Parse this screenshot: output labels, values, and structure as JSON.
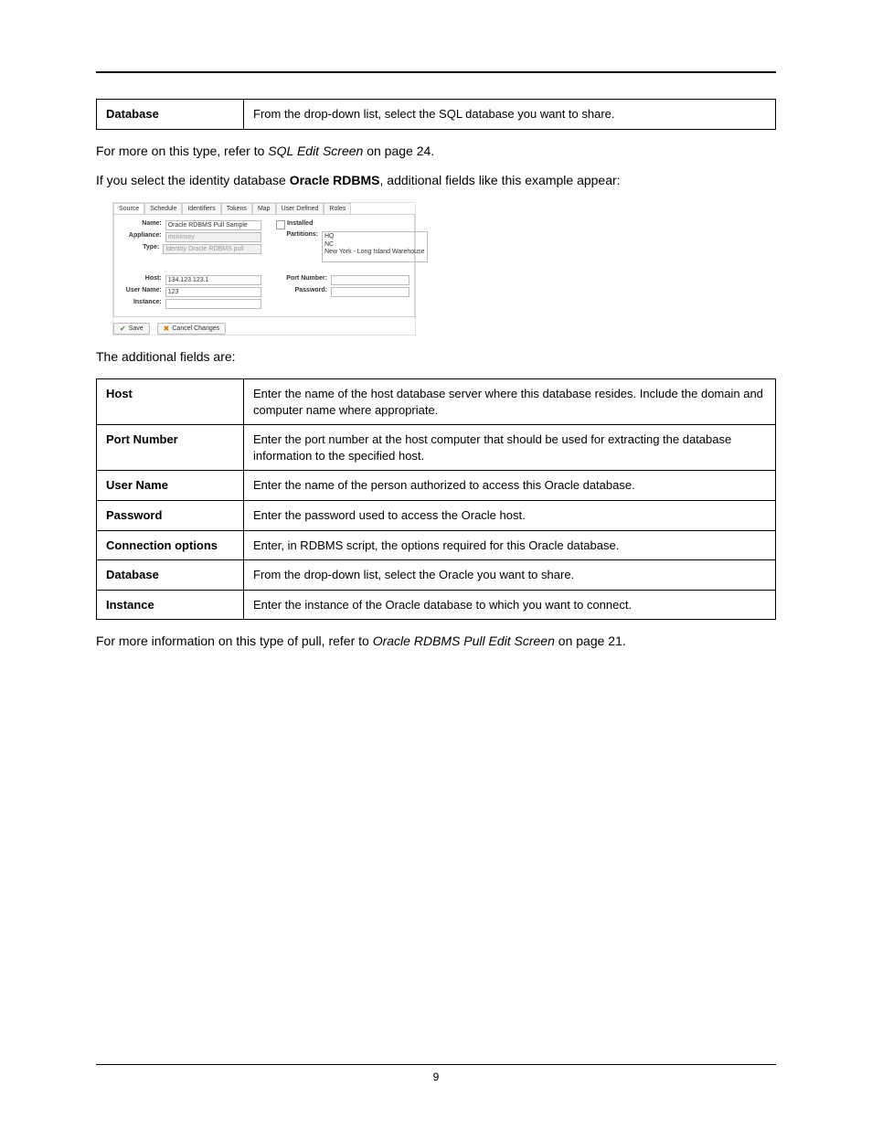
{
  "top_table": {
    "field": "Database",
    "desc": "From the drop-down list, select the SQL database you want to share."
  },
  "p1": {
    "prefix": "For more on this type, refer to ",
    "ital": "SQL Edit Screen",
    "suffix": " on page 24."
  },
  "p2": {
    "prefix": "If you select the identity database ",
    "bold": "Oracle RDBMS",
    "suffix": ", additional fields like this example appear:"
  },
  "shot": {
    "tabs": [
      "Source",
      "Schedule",
      "Identifiers",
      "Tokens",
      "Map",
      "User Defined",
      "Roles"
    ],
    "labels": {
      "name": "Name:",
      "appliance": "Appliance:",
      "type": "Type:",
      "installed": "Installed",
      "partitions": "Partitions:",
      "host": "Host:",
      "port": "Port Number:",
      "user": "User Name:",
      "password": "Password:",
      "instance": "Instance:"
    },
    "values": {
      "name": "Oracle RDBMS Pull Sample",
      "appliance": "mckinsey",
      "type": "Identity Oracle RDBMS pull",
      "host": "134.123.123.1",
      "user": "123",
      "partitions": [
        "HQ",
        "NC",
        "New York - Long Island Warehouse"
      ]
    },
    "buttons": {
      "save": "Save",
      "cancel": "Cancel Changes"
    }
  },
  "p3": "The additional fields are:",
  "fields_table": [
    {
      "k": "Host",
      "v": "Enter the name of the host database server where this database resides. Include the domain and computer name where appropriate."
    },
    {
      "k": "Port Number",
      "v": "Enter the port number at the host computer that should be used for extracting the database information to the specified host."
    },
    {
      "k": "User Name",
      "v": "Enter the name of the person authorized to access this Oracle database."
    },
    {
      "k": "Password",
      "v": "Enter the password used to access the Oracle host."
    },
    {
      "k": "Connection options",
      "v": "Enter, in RDBMS script, the options required for this Oracle database."
    },
    {
      "k": "Database",
      "v": "From the drop-down list, select the Oracle you want to share."
    },
    {
      "k": "Instance",
      "v": "Enter the instance of the Oracle database to which you want to connect."
    }
  ],
  "p4": {
    "prefix": "For more information on this type of pull, refer to ",
    "ital": "Oracle RDBMS Pull Edit Screen",
    "suffix": " on page 21."
  },
  "page_number": "9"
}
